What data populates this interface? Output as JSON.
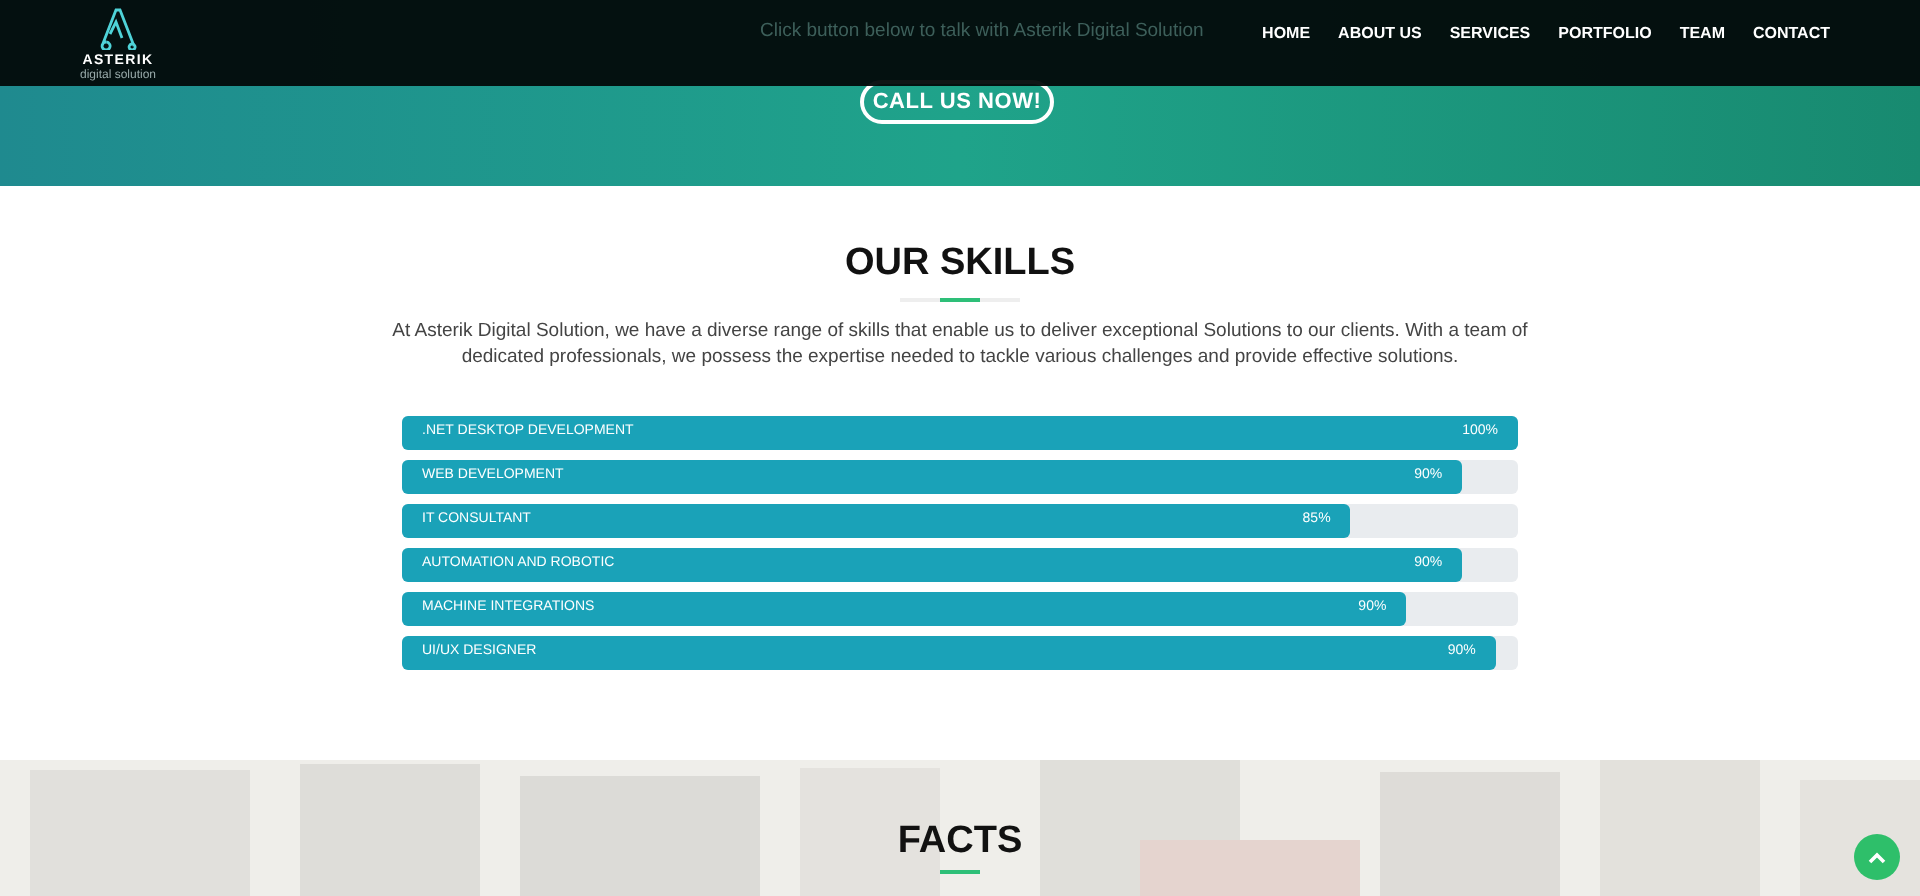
{
  "header": {
    "logo": {
      "name": "ASTERIK",
      "tagline": "digital solution"
    },
    "nav": [
      {
        "label": "HOME"
      },
      {
        "label": "ABOUT US"
      },
      {
        "label": "SERVICES"
      },
      {
        "label": "PORTFOLIO"
      },
      {
        "label": "TEAM"
      },
      {
        "label": "CONTACT"
      }
    ]
  },
  "hero": {
    "text": "Click button below to talk with Asterik Digital Solution",
    "button": "CALL US NOW!"
  },
  "skills": {
    "title": "OUR SKILLS",
    "description": "At Asterik Digital Solution, we have a diverse range of skills that enable us to deliver exceptional Solutions to our clients. With a team of dedicated professionals, we possess the expertise needed to tackle various challenges and provide effective solutions.",
    "bars": [
      {
        "name": ".NET DESKTOP DEVELOPMENT",
        "reading": "100%",
        "level": 1
      },
      {
        "name": "WEB DEVELOPMENT",
        "reading": "90%",
        "level": 0.95
      },
      {
        "name": "IT CONSULTANT",
        "reading": "85%",
        "level": 0.85
      },
      {
        "name": "AUTOMATION AND ROBOTIC",
        "reading": "90%",
        "level": 0.95
      },
      {
        "name": "MACHINE INTEGRATIONS",
        "reading": "90%",
        "level": 0.9
      },
      {
        "name": "UI/UX DESIGNER",
        "reading": "90%",
        "level": 0.98
      }
    ]
  },
  "facts": {
    "title": "FACTS"
  }
}
